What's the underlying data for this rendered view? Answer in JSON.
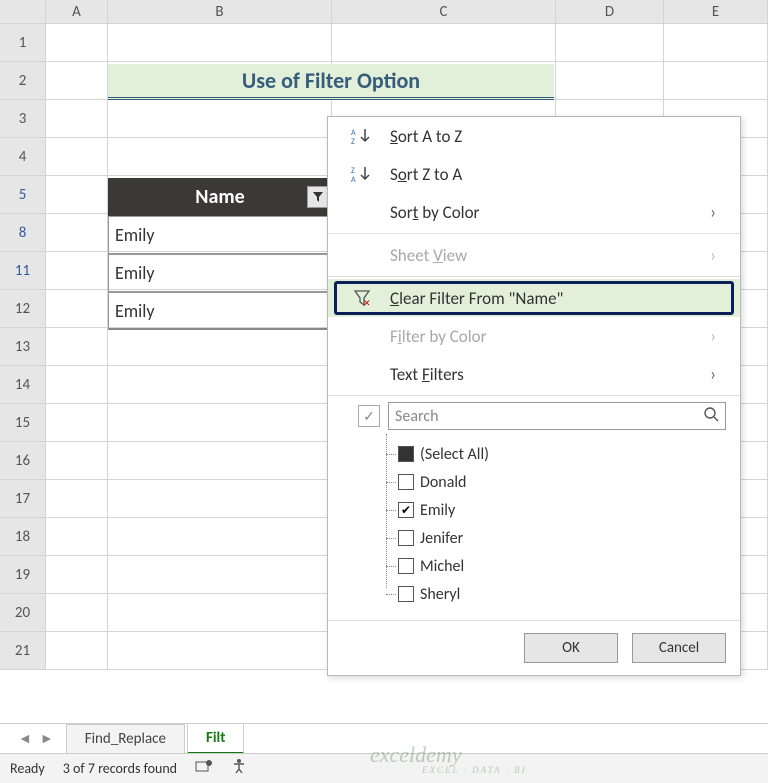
{
  "columns": [
    "A",
    "B",
    "C",
    "D",
    "E"
  ],
  "rows": [
    "1",
    "2",
    "3",
    "4",
    "5",
    "8",
    "11",
    "12",
    "13",
    "14",
    "15",
    "16",
    "17",
    "18",
    "19",
    "20",
    "21"
  ],
  "title": "Use of Filter Option",
  "table": {
    "header": "Name",
    "data": [
      "Emily",
      "Emily",
      "Emily"
    ]
  },
  "menu": {
    "sort_az": "Sort A to Z",
    "sort_za": "Sort Z to A",
    "sort_color": "Sort by Color",
    "sheet_view": "Sheet View",
    "clear_filter": "Clear Filter From \"Name\"",
    "filter_color": "Filter by Color",
    "text_filters": "Text Filters",
    "search_placeholder": "Search",
    "items": [
      {
        "label": "(Select All)",
        "state": "indeterminate"
      },
      {
        "label": "Donald",
        "state": "unchecked"
      },
      {
        "label": "Emily",
        "state": "checked"
      },
      {
        "label": "Jenifer",
        "state": "unchecked"
      },
      {
        "label": "Michel",
        "state": "unchecked"
      },
      {
        "label": "Sheryl",
        "state": "unchecked"
      }
    ],
    "ok": "OK",
    "cancel": "Cancel"
  },
  "tabs": {
    "tab1": "Find_Replace",
    "tab2": "Filt"
  },
  "status": {
    "ready": "Ready",
    "records": "3 of 7 records found"
  },
  "watermark": {
    "brand": "exceldemy",
    "tag": "EXCEL · DATA · BI"
  }
}
